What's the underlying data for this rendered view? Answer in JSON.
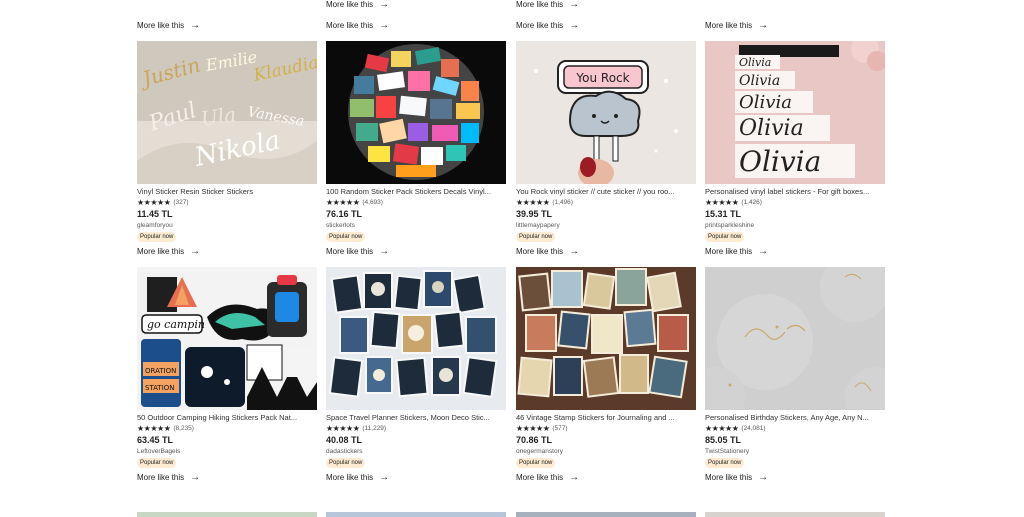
{
  "top_more_links": [
    {
      "label": "More like this",
      "arrow": "→"
    },
    {
      "label": "More like this",
      "arrow": "→"
    },
    {
      "label": "More like this",
      "arrow": "→"
    },
    {
      "label": "More like this",
      "arrow": "→"
    }
  ],
  "top_partial_links": [
    {
      "label": "More like this",
      "arrow": "→"
    },
    {
      "label": "More like this",
      "arrow": "→"
    }
  ],
  "listings": [
    {
      "title": "Vinyl Sticker Resin Sticker Stickers",
      "stars": "★★★★★",
      "count": "(327)",
      "price": "11.45 TL",
      "shop": "gleamforyou",
      "badge": "Popular now",
      "more": "More like this",
      "arrow": "→",
      "image": "name-decals-gold"
    },
    {
      "title": "100 Random Sticker Pack Stickers Decals Vinyl...",
      "stars": "★★★★★",
      "count": "(4,693)",
      "price": "76.16 TL",
      "shop": "stickerlots",
      "badge": "Popular now",
      "more": "More like this",
      "arrow": "→",
      "image": "sticker-pile-circle"
    },
    {
      "title": "You Rock vinyl sticker // cute sticker // you roo...",
      "stars": "★★★★★",
      "count": "(1,496)",
      "price": "39.95 TL",
      "shop": "littlemaypapery",
      "badge": "Popular now",
      "more": "More like this",
      "arrow": "→",
      "image": "you-rock-sticker"
    },
    {
      "title": "Personalised vinyl label stickers - For gift boxes...",
      "stars": "★★★★★",
      "count": "(1,426)",
      "price": "15.31 TL",
      "shop": "printsparkleshine",
      "badge": "Popular now",
      "more": "More like this",
      "arrow": "→",
      "image": "olivia-labels"
    },
    {
      "title": "50 Outdoor Camping Hiking Stickers Pack Nat...",
      "stars": "★★★★★",
      "count": "(8,235)",
      "price": "63.45 TL",
      "shop": "LeftoverBagels",
      "badge": "Popular now",
      "more": "More like this",
      "arrow": "→",
      "image": "camping-stickers"
    },
    {
      "title": "Space Travel Planner Stickers, Moon Deco Stic...",
      "stars": "★★★★★",
      "count": "(11,229)",
      "price": "40.08 TL",
      "shop": "dadastickers",
      "badge": "Popular now",
      "more": "More like this",
      "arrow": "→",
      "image": "space-stamps"
    },
    {
      "title": "46 Vintage Stamp Stickers for Journaling and ...",
      "stars": "★★★★★",
      "count": "(577)",
      "price": "70.86 TL",
      "shop": "onegermanstory",
      "badge": "Popular now",
      "more": "More like this",
      "arrow": "→",
      "image": "vintage-stamps"
    },
    {
      "title": "Personalised Birthday Stickers, Any Age, Any N...",
      "stars": "★★★★★",
      "count": "(24,081)",
      "price": "85.05 TL",
      "shop": "TwistStationery",
      "badge": "Popular now",
      "more": "More like this",
      "arrow": "→",
      "image": "birthday-stickers-gold"
    }
  ],
  "colors": {
    "badge_bg": "#fdebd2",
    "text": "#222222",
    "muted": "#595959"
  }
}
